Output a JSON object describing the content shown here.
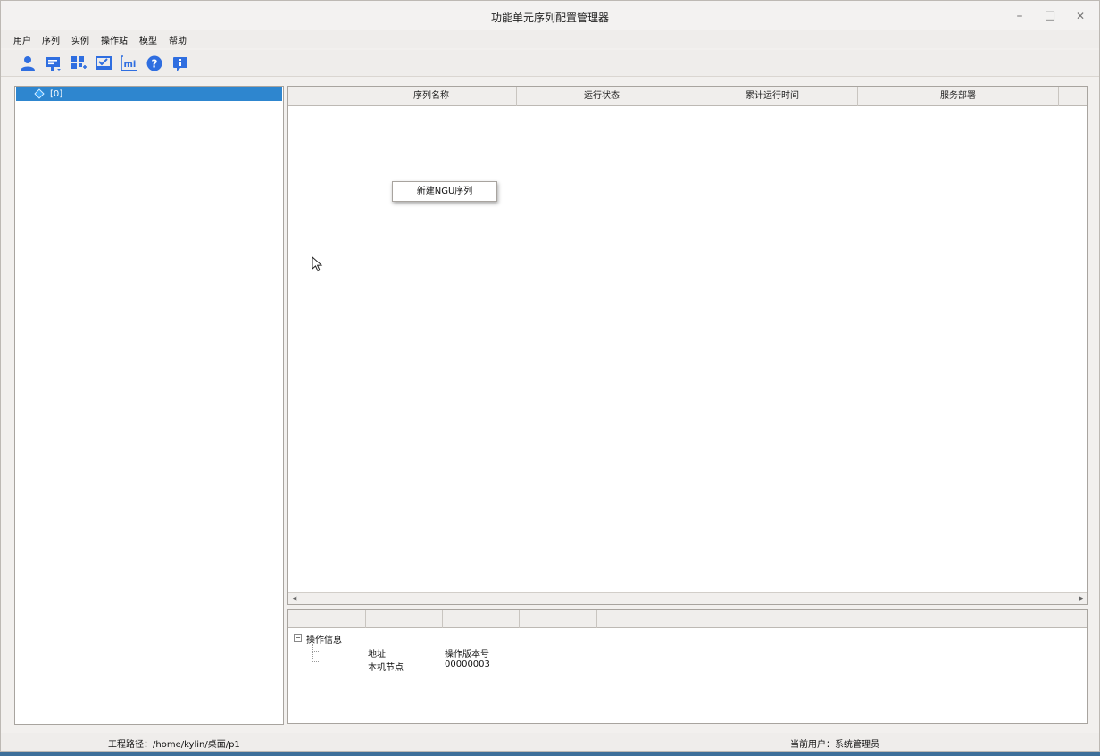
{
  "window": {
    "title": "功能单元序列配置管理器",
    "controls": {
      "minimize": "–",
      "maximize": "□",
      "close": "✕"
    }
  },
  "menubar": {
    "items": [
      "用户",
      "序列",
      "实例",
      "操作站",
      "模型",
      "帮助"
    ]
  },
  "toolbar": {
    "icons": [
      "user-icon",
      "sequence-icon",
      "instance-icon",
      "station-icon",
      "model-icon",
      "help-icon",
      "info-icon"
    ],
    "accent_color": "#2f6ee0",
    "model_icon_text": "mi"
  },
  "tree": {
    "selected_label": "[0]",
    "selection_color": "#2e86cf"
  },
  "table": {
    "columns": [
      "",
      "序列名称",
      "运行状态",
      "累计运行时间",
      "服务部署"
    ]
  },
  "context_menu": {
    "items": [
      "新建NGU序列"
    ]
  },
  "info": {
    "root_label": "操作信息",
    "rows": [
      {
        "key": "地址",
        "value": "操作版本号"
      },
      {
        "key": "本机节点",
        "value": "00000003"
      }
    ]
  },
  "status": {
    "project_path": "工程路径：/home/kylin/桌面/p1",
    "current_user": "当前用户：系统管理员"
  }
}
